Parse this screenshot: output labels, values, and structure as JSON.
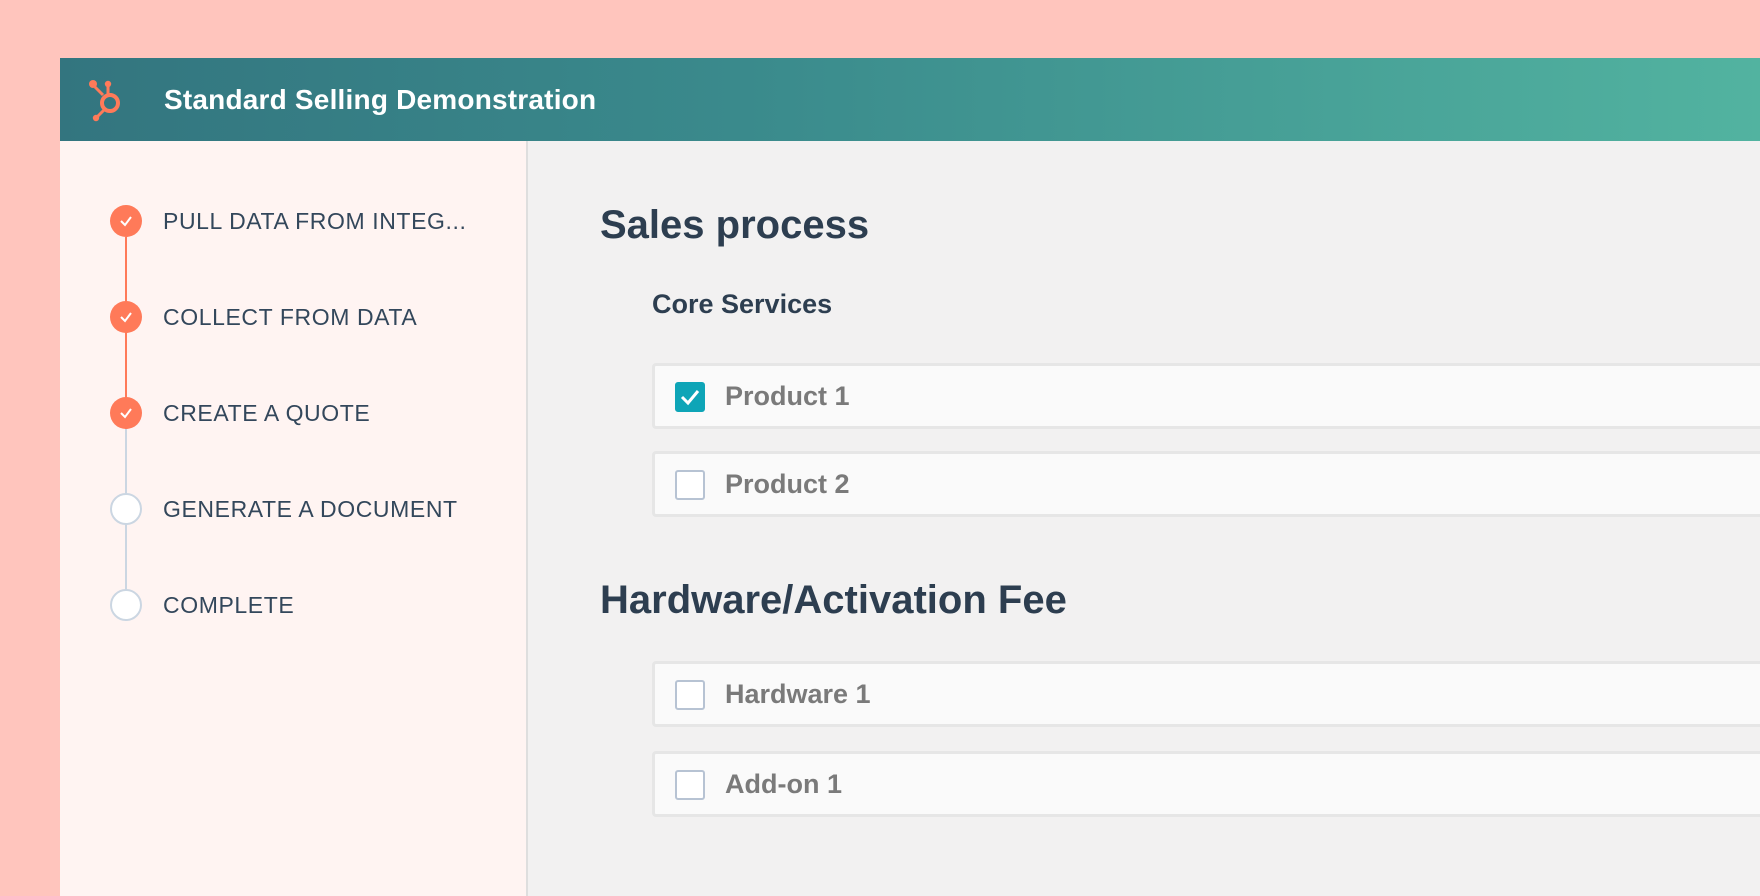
{
  "header": {
    "title": "Standard Selling Demonstration",
    "logo_icon": "hubspot-sprocket-icon",
    "accent_color": "#ff7a59"
  },
  "sidebar": {
    "steps": [
      {
        "label": "PULL DATA FROM INTEG...",
        "status": "complete"
      },
      {
        "label": "COLLECT FROM DATA",
        "status": "complete"
      },
      {
        "label": "CREATE A QUOTE",
        "status": "complete"
      },
      {
        "label": "GENERATE A DOCUMENT",
        "status": "pending"
      },
      {
        "label": "COMPLETE",
        "status": "pending"
      }
    ]
  },
  "main": {
    "sections": [
      {
        "title": "Sales process",
        "groups": [
          {
            "title": "Core Services",
            "options": [
              {
                "label": "Product 1",
                "checked": true
              },
              {
                "label": "Product 2",
                "checked": false
              }
            ]
          }
        ]
      },
      {
        "title": "Hardware/Activation Fee",
        "groups": [
          {
            "title": "",
            "options": [
              {
                "label": "Hardware 1",
                "checked": false
              },
              {
                "label": "Add-on 1",
                "checked": false
              }
            ]
          }
        ]
      }
    ]
  }
}
